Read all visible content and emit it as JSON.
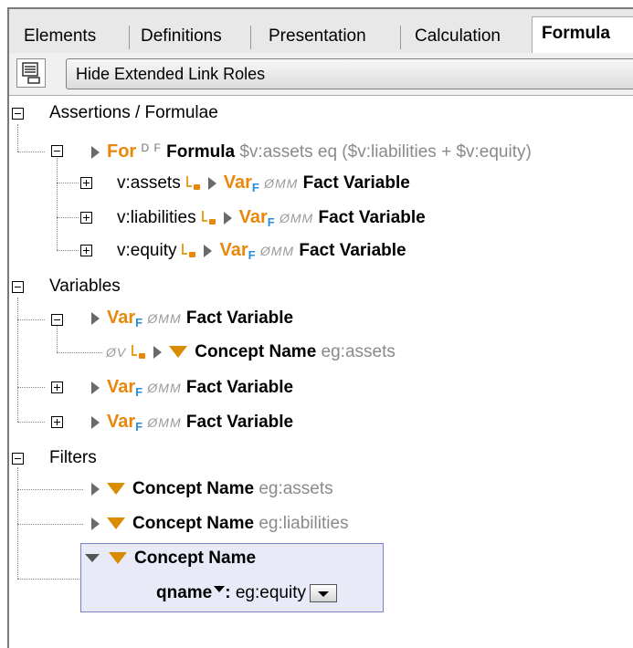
{
  "tabs": [
    {
      "label": "Elements",
      "active": false
    },
    {
      "label": "Definitions",
      "active": false
    },
    {
      "label": "Presentation",
      "active": false
    },
    {
      "label": "Calculation",
      "active": false
    },
    {
      "label": "Formula",
      "active": true
    }
  ],
  "toolbar": {
    "hide_roles_label": "Hide Extended Link Roles",
    "icon": "link-roles-icon"
  },
  "tree": {
    "assertions": {
      "label": "Assertions / Formulae",
      "formula": {
        "keyword": "For",
        "flags": "D F",
        "name": "Formula",
        "expression": "$v:assets eq ($v:liabilities + $v:equity)"
      },
      "vars": [
        {
          "name": "v:assets",
          "keyword": "Var",
          "sub": "F",
          "flags": "ØMM",
          "type": "Fact Variable"
        },
        {
          "name": "v:liabilities",
          "keyword": "Var",
          "sub": "F",
          "flags": "ØMM",
          "type": "Fact Variable"
        },
        {
          "name": "v:equity",
          "keyword": "Var",
          "sub": "F",
          "flags": "ØMM",
          "type": "Fact Variable"
        }
      ]
    },
    "variables": {
      "label": "Variables",
      "items": [
        {
          "keyword": "Var",
          "sub": "F",
          "flags": "ØMM",
          "type": "Fact Variable",
          "child": {
            "flags": "ØV",
            "type": "Concept Name",
            "value": "eg:assets"
          }
        },
        {
          "keyword": "Var",
          "sub": "F",
          "flags": "ØMM",
          "type": "Fact Variable"
        },
        {
          "keyword": "Var",
          "sub": "F",
          "flags": "ØMM",
          "type": "Fact Variable"
        }
      ]
    },
    "filters": {
      "label": "Filters",
      "items": [
        {
          "type": "Concept Name",
          "value": "eg:assets"
        },
        {
          "type": "Concept Name",
          "value": "eg:liabilities"
        }
      ],
      "selected": {
        "type": "Concept Name",
        "field": "qname",
        "sep": ":",
        "value": "eg:equity"
      }
    }
  },
  "colors": {
    "accent": "#e8870a",
    "sub": "#2a8fd8",
    "selection": "#e8eaf8"
  }
}
